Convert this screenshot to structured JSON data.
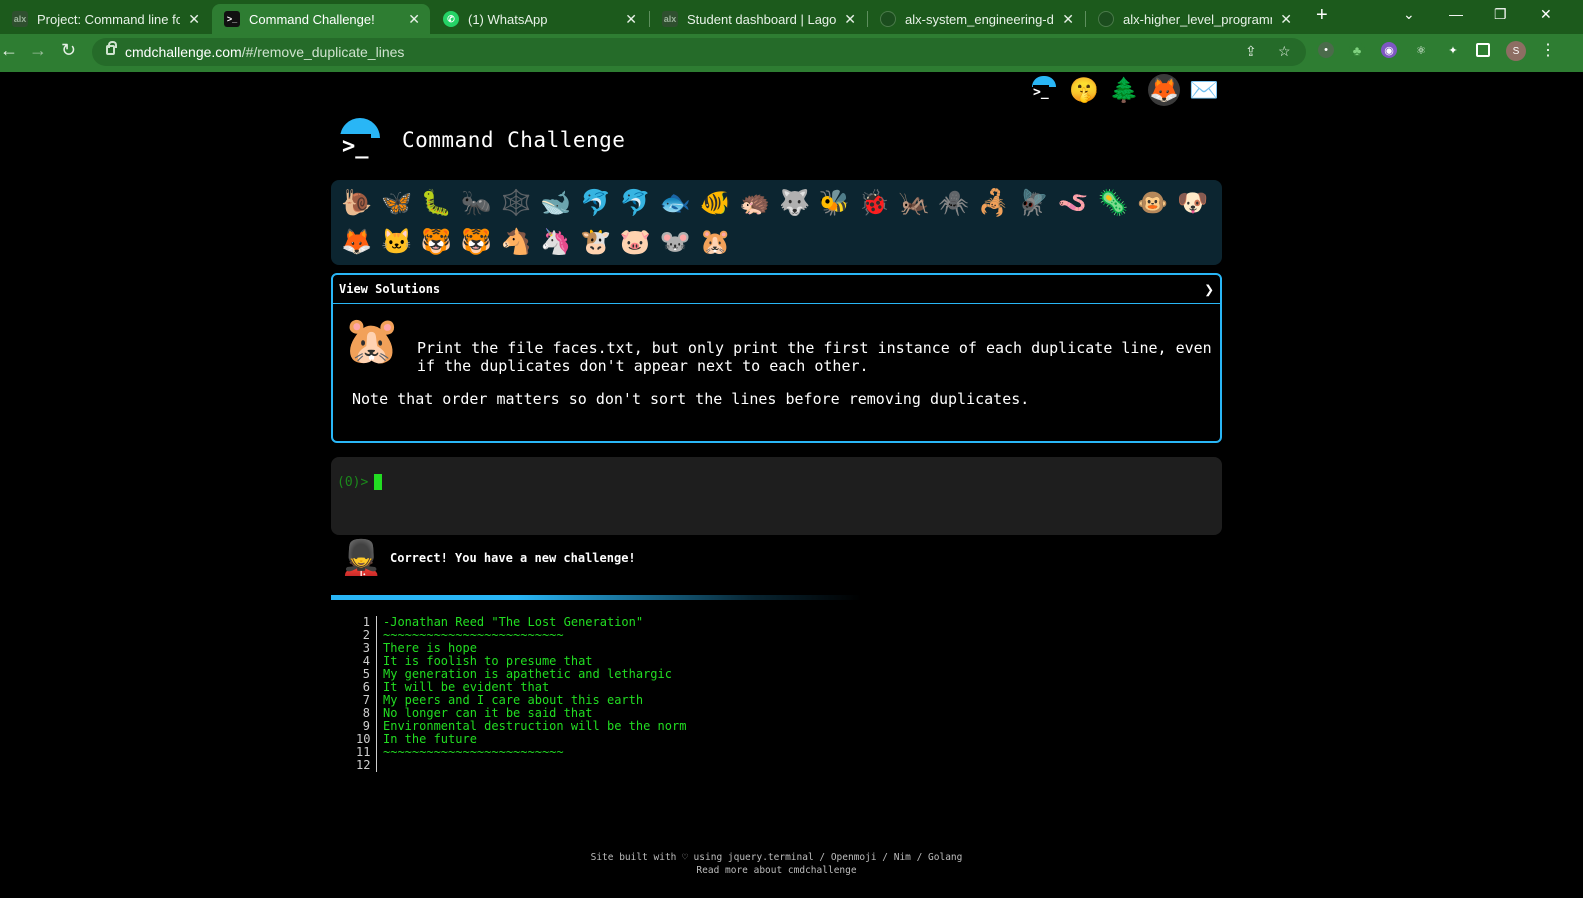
{
  "browser": {
    "tabs": [
      {
        "title": "Project: Command line for the",
        "favicon": "alx-icon",
        "active": false
      },
      {
        "title": "Command Challenge!",
        "favicon": "terminal-icon",
        "active": true
      },
      {
        "title": "(1) WhatsApp",
        "favicon": "whatsapp-icon",
        "active": false
      },
      {
        "title": "Student dashboard | Lagos In",
        "favicon": "alx-icon",
        "active": false
      },
      {
        "title": "alx-system_engineering-devo",
        "favicon": "github-icon",
        "active": false
      },
      {
        "title": "alx-higher_level_programmin",
        "favicon": "github-icon",
        "active": false
      }
    ],
    "url_host": "cmdchallenge.com",
    "url_path": "/#/remove_duplicate_lines",
    "profile_initial": "S"
  },
  "header": {
    "title": "Command Challenge"
  },
  "top_icons": [
    "terminal-logo-icon",
    "shushing-face-icon",
    "tree-icon",
    "gitlab-icon",
    "envelope-icon"
  ],
  "emojis": [
    "🐌",
    "🦋",
    "🐛",
    "🐜",
    "🕸️",
    "🐋",
    "🐬",
    "🐬",
    "🐟",
    "🐠",
    "🦔",
    "🐺",
    "🐝",
    "🐞",
    "🦗",
    "🕷️",
    "🦂",
    "🪰",
    "🪱",
    "🦠",
    "🐵",
    "🐶",
    "🦊",
    "🐱",
    "🐯",
    "🐯",
    "🐴",
    "🦄",
    "🐮",
    "🐷",
    "🐭",
    "🐹"
  ],
  "challenge": {
    "view_solutions_label": "View Solutions",
    "text_main": "Print the file faces.txt, but only print the first instance of each duplicate line, even if the duplicates don't appear next to each other.",
    "text_note": "Note that order matters so don't sort the lines before removing duplicates."
  },
  "terminal": {
    "prompt": "(0)>"
  },
  "feedback": {
    "message": "Correct! You have a new challenge!"
  },
  "output": [
    {
      "n": "1",
      "text": "-Jonathan Reed \"The Lost Generation\""
    },
    {
      "n": "2",
      "text": "~~~~~~~~~~~~~~~~~~~~~~~~~"
    },
    {
      "n": "3",
      "text": "There is hope"
    },
    {
      "n": "4",
      "text": "It is foolish to presume that"
    },
    {
      "n": "5",
      "text": "My generation is apathetic and lethargic"
    },
    {
      "n": "6",
      "text": "It will be evident that"
    },
    {
      "n": "7",
      "text": "My peers and I care about this earth"
    },
    {
      "n": "8",
      "text": "No longer can it be said that"
    },
    {
      "n": "9",
      "text": "Environmental destruction will be the norm"
    },
    {
      "n": "10",
      "text": "In the future"
    },
    {
      "n": "11",
      "text": "~~~~~~~~~~~~~~~~~~~~~~~~~"
    },
    {
      "n": "12",
      "text": ""
    }
  ],
  "footer": {
    "line1": "Site built with ♡ using jquery.terminal / Openmoji / Nim / Golang",
    "line2": "Read more about cmdchallenge"
  },
  "colors": {
    "accent": "#29b6f6",
    "terminal_green": "#22dd22",
    "browser_green": "#2e7d32"
  }
}
